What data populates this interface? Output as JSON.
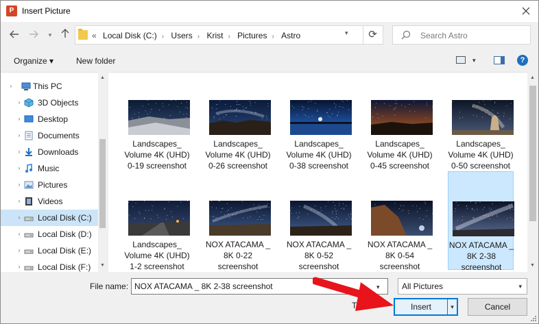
{
  "window": {
    "title": "Insert Picture",
    "app_icon_letter": "P"
  },
  "address": {
    "crumbs": [
      "Local Disk (C:)",
      "Users",
      "Krist",
      "Pictures",
      "Astro"
    ],
    "overflow": "«"
  },
  "search": {
    "placeholder": "Search Astro"
  },
  "toolbar": {
    "organize": "Organize ▾",
    "new_folder": "New folder",
    "help": "?"
  },
  "nav": {
    "items": [
      {
        "label": "This PC",
        "icon": "computer-icon",
        "expand": "›"
      },
      {
        "label": "3D Objects",
        "icon": "cube-icon",
        "expand": "›"
      },
      {
        "label": "Desktop",
        "icon": "desktop-icon",
        "expand": "›"
      },
      {
        "label": "Documents",
        "icon": "documents-icon",
        "expand": "›"
      },
      {
        "label": "Downloads",
        "icon": "download-icon",
        "expand": "›"
      },
      {
        "label": "Music",
        "icon": "music-icon",
        "expand": "›"
      },
      {
        "label": "Pictures",
        "icon": "pictures-icon",
        "expand": "›"
      },
      {
        "label": "Videos",
        "icon": "videos-icon",
        "expand": "›"
      },
      {
        "label": "Local Disk (C:)",
        "icon": "drive-icon",
        "expand": "›",
        "selected": true
      },
      {
        "label": "Local Disk (D:)",
        "icon": "drive-icon",
        "expand": "›"
      },
      {
        "label": "Local Disk (E:)",
        "icon": "drive-icon",
        "expand": "›"
      },
      {
        "label": "Local Disk (F:)",
        "icon": "drive-icon",
        "expand": "›"
      }
    ]
  },
  "files": [
    {
      "l1": "Landscapes_",
      "l2": "Volume 4K (UHD)",
      "l3": "0-19 screenshot",
      "scene": "rocks"
    },
    {
      "l1": "Landscapes_",
      "l2": "Volume 4K (UHD)",
      "l3": "0-26 screenshot",
      "scene": "hills"
    },
    {
      "l1": "Landscapes_",
      "l2": "Volume 4K (UHD)",
      "l3": "0-38 screenshot",
      "scene": "lake"
    },
    {
      "l1": "Landscapes_",
      "l2": "Volume 4K (UHD)",
      "l3": "0-45 screenshot",
      "scene": "dusk"
    },
    {
      "l1": "Landscapes_",
      "l2": "Volume 4K (UHD)",
      "l3": "0-50 screenshot",
      "scene": "arch"
    },
    {
      "l1": "Landscapes_",
      "l2": "Volume 4K (UHD)",
      "l3": "1-2 screenshot",
      "scene": "road"
    },
    {
      "l1": "NOX ATACAMA _",
      "l2": "8K 0-22",
      "l3": "screenshot",
      "scene": "desert"
    },
    {
      "l1": "NOX ATACAMA _",
      "l2": "8K 0-52",
      "l3": "screenshot",
      "scene": "horizon"
    },
    {
      "l1": "NOX ATACAMA _",
      "l2": "8K 0-54",
      "l3": "screenshot",
      "scene": "cliff"
    },
    {
      "l1": "NOX ATACAMA _",
      "l2": "8K 2-38",
      "l3": "screenshot",
      "scene": "milkyway",
      "selected": true
    }
  ],
  "bottom": {
    "file_name_label": "File name:",
    "file_name_value": "NOX ATACAMA _ 8K 2-38 screenshot",
    "filter": "All Pictures",
    "tools": "Tools",
    "insert": "Insert",
    "cancel": "Cancel"
  },
  "colors": {
    "accent": "#0078d7",
    "selection": "#cce8ff",
    "arrow": "#e8131b"
  }
}
